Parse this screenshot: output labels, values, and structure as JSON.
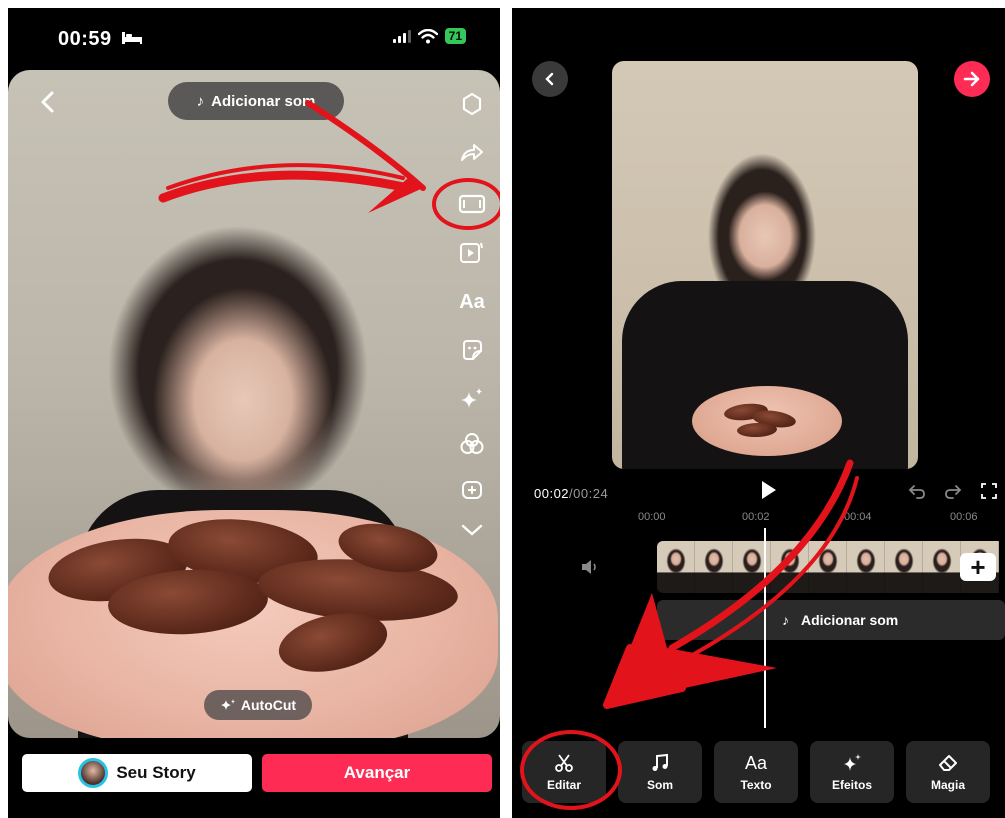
{
  "left_screen": {
    "status_bar": {
      "time": "00:59",
      "battery": "71"
    },
    "add_sound_pill": {
      "label": "Adicionar som"
    },
    "sidebar_icon_text": "Aa",
    "autocut": {
      "label": "AutoCut"
    },
    "buttons": {
      "story_label": "Seu Story",
      "next_label": "Avançar"
    }
  },
  "right_screen": {
    "time_readout": {
      "current": "00:02",
      "total": "00:24"
    },
    "ruler_ticks": [
      "00:00",
      "00:02",
      "00:04",
      "00:06"
    ],
    "sound_track": {
      "label": "Adicionar som"
    },
    "toolbar": [
      {
        "label": "Editar",
        "icon": "scissors-icon"
      },
      {
        "label": "Som",
        "icon": "music-note-icon"
      },
      {
        "label": "Texto",
        "icon": "text-icon",
        "glyph": "Aa"
      },
      {
        "label": "Efeitos",
        "icon": "sparkle-icon"
      },
      {
        "label": "Magia",
        "icon": "magic-eraser-icon"
      }
    ]
  },
  "colors": {
    "accent": "#fe2c55",
    "annotation_red": "#e3131b",
    "battery_green": "#34c759",
    "avatar_ring": "#27c3e6"
  }
}
